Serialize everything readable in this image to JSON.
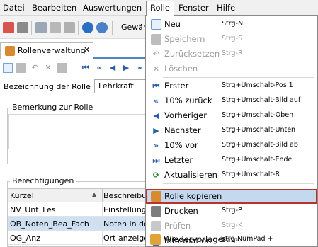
{
  "menubar": {
    "items": [
      {
        "label": "Datei"
      },
      {
        "label": "Bearbeiten"
      },
      {
        "label": "Auswertungen"
      },
      {
        "label": "Rolle"
      },
      {
        "label": "Fenster"
      },
      {
        "label": "Hilfe"
      }
    ]
  },
  "toolbar": {
    "truncated_text": "Gewäh"
  },
  "tab": {
    "label": "Rollenverwaltung",
    "close": "✕"
  },
  "form": {
    "role_label": "Bezeichnung der Rolle",
    "role_value": "Lehrkraft",
    "remark_label": "Bemerkung zur Rolle",
    "permissions_label": "Berechtigungen"
  },
  "grid": {
    "columns": [
      "Kürzel",
      "Beschreibun"
    ],
    "rows": [
      {
        "code": "NV_Unt_Les",
        "desc": "Einstellunge"
      },
      {
        "code": "OB_Noten_Bea_Fach",
        "desc": "Noten in de"
      },
      {
        "code": "OG_Anz",
        "desc": "Ort anzeige"
      }
    ]
  },
  "menu": {
    "items": [
      {
        "label": "Neu",
        "shortcut": "Strg-N",
        "icon": "new-doc-icon",
        "enabled": true
      },
      {
        "label": "Speichern",
        "shortcut": "Strg-S",
        "icon": "save-icon",
        "enabled": false
      },
      {
        "label": "Zurücksetzen",
        "shortcut": "Strg-R",
        "icon": "undo-icon",
        "enabled": false
      },
      {
        "label": "Löschen",
        "shortcut": "",
        "icon": "delete-icon",
        "enabled": false
      },
      {
        "label": "Erster",
        "shortcut": "Strg+Umschalt-Pos 1",
        "icon": "first-record-icon",
        "enabled": true
      },
      {
        "label": "10% zurück",
        "shortcut": "Strg+Umschalt-Bild auf",
        "icon": "back-10-icon",
        "enabled": true
      },
      {
        "label": "Vorheriger",
        "shortcut": "Strg+Umschalt-Oben",
        "icon": "previous-icon",
        "enabled": true
      },
      {
        "label": "Nächster",
        "shortcut": "Strg+Umschalt-Unten",
        "icon": "next-icon",
        "enabled": true
      },
      {
        "label": "10% vor",
        "shortcut": "Strg+Umschalt-Bild ab",
        "icon": "forward-10-icon",
        "enabled": true
      },
      {
        "label": "Letzter",
        "shortcut": "Strg+Umschalt-Ende",
        "icon": "last-record-icon",
        "enabled": true
      },
      {
        "label": "Aktualisieren",
        "shortcut": "Strg+Umschalt-R",
        "icon": "refresh-icon",
        "enabled": true
      },
      {
        "label": "Rolle kopieren",
        "shortcut": "",
        "icon": "copy-role-icon",
        "enabled": true,
        "highlighted": true
      },
      {
        "label": "Drucken",
        "shortcut": "Strg-P",
        "icon": "print-icon",
        "enabled": true
      },
      {
        "label": "Prüfen",
        "shortcut": "Strg-K",
        "icon": "check-icon",
        "enabled": false
      },
      {
        "label": "Information",
        "shortcut": "Strg-I",
        "icon": "info-icon",
        "enabled": true
      },
      {
        "label": "Wiedervorlage",
        "shortcut": "Strg-NumPad +",
        "icon": "reminder-icon",
        "enabled": true
      }
    ]
  },
  "colors": {
    "accent": "#4a86c8",
    "highlight_bg": "#c5d9ee",
    "highlight_border": "#b8322e",
    "icon_blue": "#2a5ea8",
    "disabled_text": "#9d9d9d"
  }
}
